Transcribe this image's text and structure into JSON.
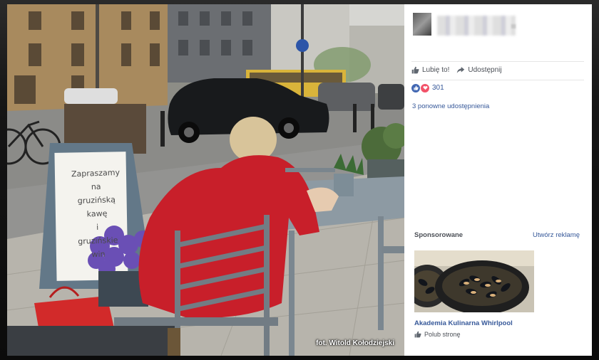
{
  "photo": {
    "credit": "fot. Witold Kołodziejski",
    "board_text": "Zapraszamy na\ngruzińską\nkawę\ni\ngruzińskie\nwin"
  },
  "post": {
    "like_label": "Lubię to!",
    "share_label": "Udostępnij",
    "reaction_count": "301",
    "shares_text": "3 ponowne udostępnienia"
  },
  "sponsored": {
    "title": "Sponsorowane",
    "create_ad": "Utwórz reklamę",
    "ad_title": "Akademia Kulinarna Whirlpool",
    "ad_like": "Polub stronę"
  },
  "colors": {
    "link": "#365899",
    "like_blue": "#4267b2",
    "love_red": "#f25268"
  },
  "icons": [
    "thumbs-up-icon",
    "share-arrow-icon",
    "like-reaction-icon",
    "love-reaction-icon"
  ]
}
